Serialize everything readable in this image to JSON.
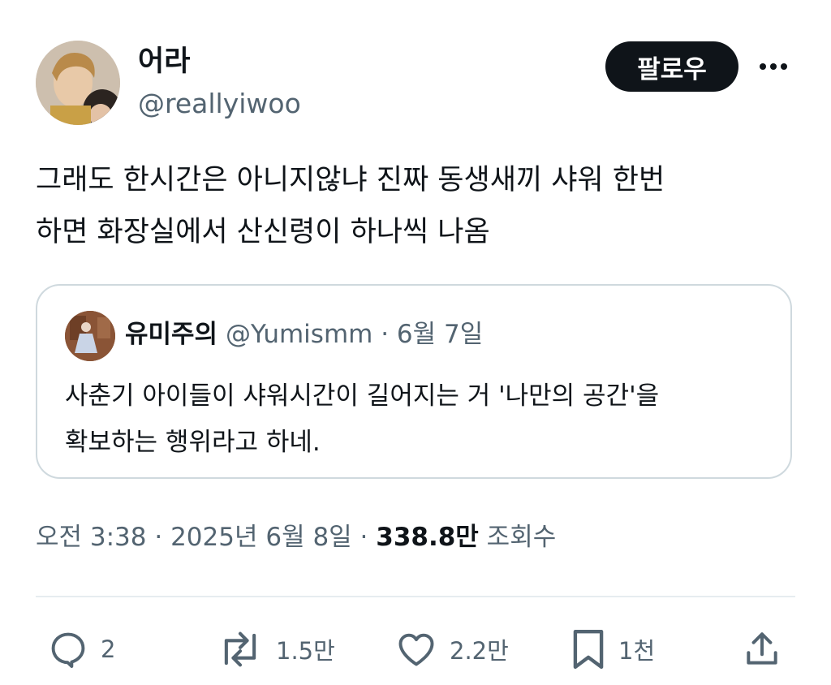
{
  "author": {
    "display_name": "어라",
    "handle": "@reallyiwoo"
  },
  "follow_button": {
    "label": "팔로우"
  },
  "tweet": {
    "text": "그래도 한시간은 아니지않냐 진짜 동생새끼 샤워 한번\n하면 화장실에서 산신령이 하나씩 나옴"
  },
  "quoted": {
    "display_name": "유미주의",
    "handle": "@Yumismm",
    "separator": " · ",
    "date": "6월 7일",
    "text": "사춘기 아이들이 샤워시간이 길어지는 거 '나만의 공간'을\n확보하는 행위라고 하네."
  },
  "meta": {
    "time": "오전 3:38",
    "separator": " · ",
    "date": "2025년 6월 8일",
    "views_count": "338.8만",
    "views_label": " 조회수"
  },
  "actions": {
    "reply_count": "2",
    "retweet_count": "1.5만",
    "like_count": "2.2만",
    "bookmark_count": "1천"
  },
  "icons": {
    "reply": "reply-icon",
    "retweet": "retweet-icon",
    "like": "heart-icon",
    "bookmark": "bookmark-icon",
    "share": "share-icon",
    "more": "more-icon"
  },
  "colors": {
    "text_primary": "#0f1419",
    "text_secondary": "#536471",
    "border": "#cfd9de",
    "button_bg": "#0f1419"
  }
}
